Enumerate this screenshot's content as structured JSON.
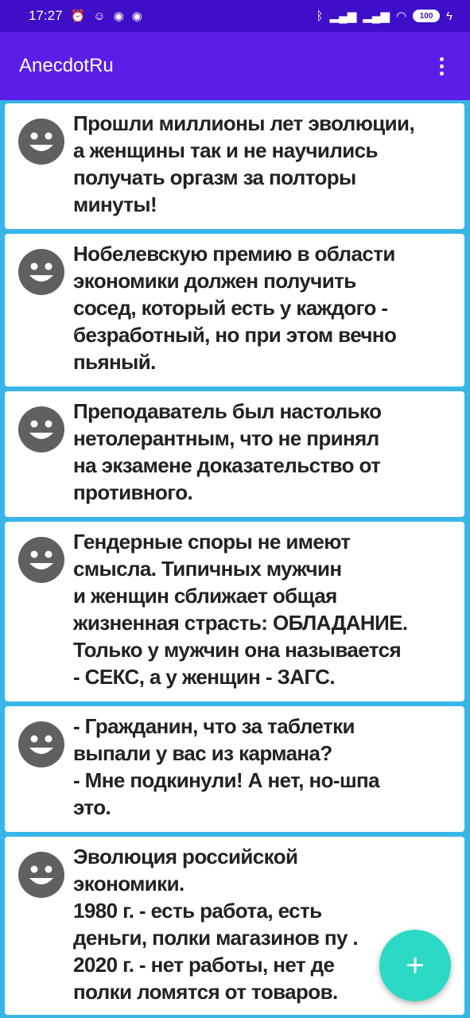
{
  "status_bar": {
    "time": "17:27",
    "left_icons": [
      "alarm-icon",
      "face-icon",
      "notification-icon",
      "notification-icon"
    ],
    "right_icons": [
      "bluetooth-icon",
      "signal-icon",
      "signal-icon",
      "wifi-icon"
    ],
    "battery": "100"
  },
  "app_bar": {
    "title": "AnecdotRu",
    "menu_icon": "more-vert-icon"
  },
  "jokes": [
    {
      "text": "Прошли миллионы лет эволюции,\nа женщины так и не научились\nполучать оргазм за полторы\nминуты!"
    },
    {
      "text": "Нобелевскую премию в области\nэкономики должен получить\nсосед, который есть у каждого -\nбезработный, но при этом вечно\nпьяный."
    },
    {
      "text": "Преподаватель был настолько\nнетолерантным, что не принял\nна экзамене доказательство от\nпротивного."
    },
    {
      "text": "Гендерные споры не имеют\nсмысла. Типичных мужчин\nи женщин сближает общая\nжизненная страсть: ОБЛАДАНИЕ.\nТолько у мужчин она называется\n- СЕКС, а у женщин - ЗАГС."
    },
    {
      "text": "- Гражданин, что за таблетки\nвыпали у вас из кармана?\n- Мне подкинули! А нет, но-шпа\nэто."
    },
    {
      "text": "Эволюция российской\nэкономики.\n1980 г. - есть работа, есть\nденьги, полки магазинов пу        .\n2020 г. - нет работы, нет де\nполки ломятся от товаров."
    }
  ],
  "fab": {
    "label": "+",
    "icon": "add-icon"
  },
  "colors": {
    "status_bar": "#3f0ec9",
    "app_bar": "#5a1ee8",
    "background": "#38b6e8",
    "fab": "#2cd9c4",
    "avatar": "#606060"
  }
}
